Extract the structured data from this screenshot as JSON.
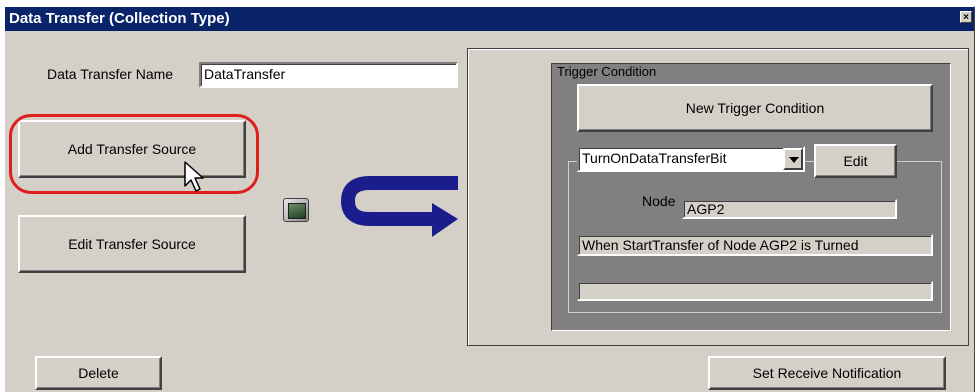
{
  "window": {
    "title": "Data Transfer (Collection Type)",
    "close_label": "×"
  },
  "transfer_name": {
    "label": "Data Transfer Name",
    "value": "DataTransfer"
  },
  "buttons": {
    "add_source": "Add Transfer Source",
    "edit_source": "Edit Transfer Source",
    "delete": "Delete",
    "set_receive": "Set Receive Notification"
  },
  "trigger": {
    "group_label": "Trigger Condition",
    "new_button": "New Trigger Condition",
    "selected_option": "TurnOnDataTransferBit",
    "edit_button": "Edit",
    "node_label": "Node",
    "node_value": "AGP2",
    "description": "When StartTransfer of Node AGP2 is Turned",
    "extra": ""
  },
  "colors": {
    "titlebar": "#0a246a",
    "highlight": "#e01d1d",
    "arrow": "#1c1d8c"
  }
}
